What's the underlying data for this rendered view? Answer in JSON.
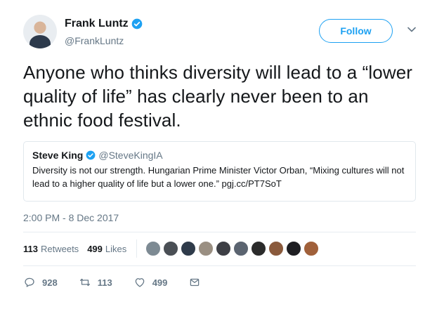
{
  "author": {
    "name": "Frank Luntz",
    "handle": "@FrankLuntz",
    "follow_label": "Follow"
  },
  "tweet": {
    "text": "Anyone who thinks diversity will lead to a “lower quality of life” has clearly never been to an ethnic food festival.",
    "timestamp": "2:00 PM - 8 Dec 2017"
  },
  "quoted": {
    "name": "Steve King",
    "handle": "@SteveKingIA",
    "text": "Diversity is not our strength. Hungarian Prime Minister Victor Orban, “Mixing cultures will not lead to a higher quality of life but a lower one.” pgj.cc/PT7SoT"
  },
  "stats": {
    "retweets_count": "113",
    "retweets_label": "Retweets",
    "likes_count": "499",
    "likes_label": "Likes"
  },
  "likers": [
    "#7d8a93",
    "#4a4f55",
    "#2f3b4a",
    "#9a8f82",
    "#3d3f45",
    "#5b6470",
    "#2b2b2b",
    "#8a5a3c",
    "#1e1e22",
    "#a0603a"
  ],
  "actions": {
    "reply_count": "928",
    "retweet_count": "113",
    "like_count": "499"
  },
  "icons": {
    "verified": "verified-badge-icon",
    "chevron": "chevron-down-icon",
    "reply": "reply-icon",
    "retweet": "retweet-icon",
    "like": "heart-icon",
    "dm": "envelope-icon"
  },
  "colors": {
    "accent": "#1da1f2",
    "secondary_text": "#657786",
    "border": "#e1e8ed"
  }
}
